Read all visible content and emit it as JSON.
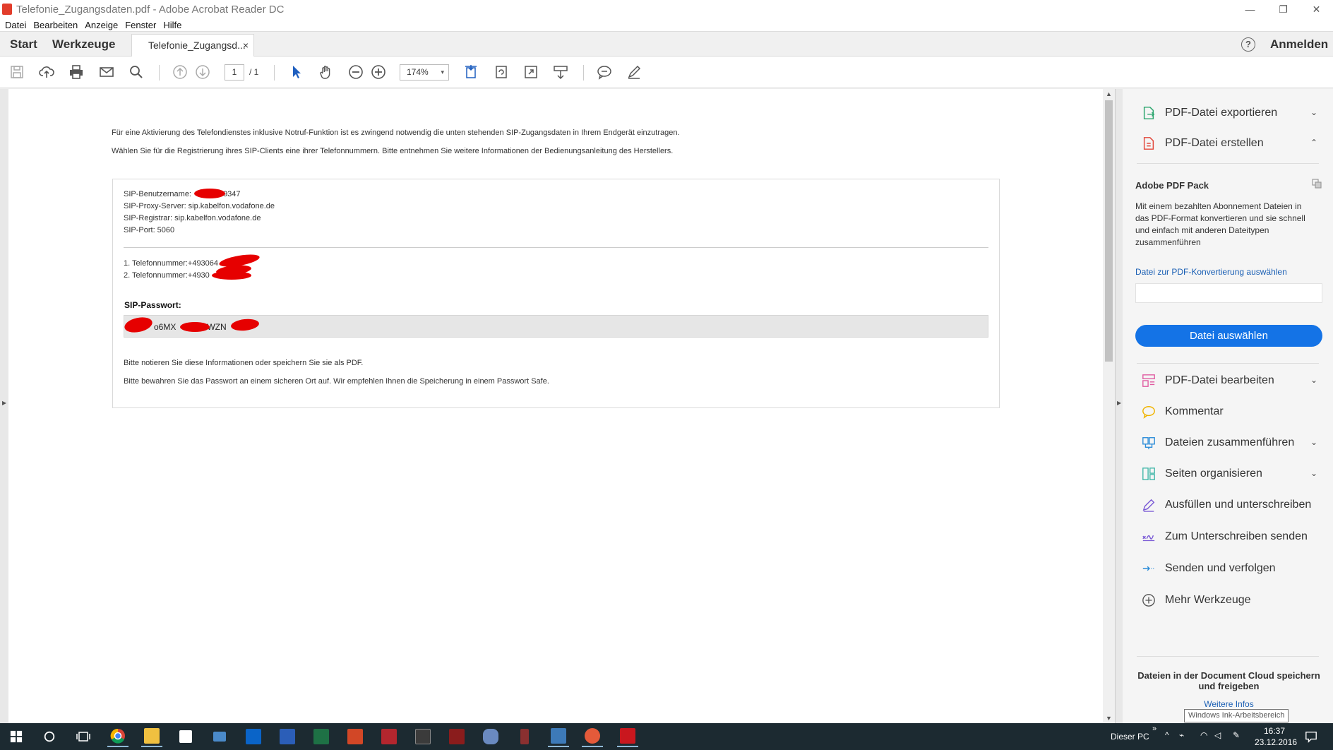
{
  "window": {
    "title": "Telefonie_Zugangsdaten.pdf - Adobe Acrobat Reader DC",
    "minimize_glyph": "—",
    "restore_glyph": "❐",
    "close_glyph": "✕"
  },
  "menu": [
    "Datei",
    "Bearbeiten",
    "Anzeige",
    "Fenster",
    "Hilfe"
  ],
  "tabs": {
    "start": "Start",
    "tools": "Werkzeuge",
    "document": "Telefonie_Zugangsd...",
    "close": "×",
    "help": "?",
    "signin": "Anmelden"
  },
  "toolbar": {
    "page_current": "1",
    "page_total": "/ 1",
    "zoom": "174%",
    "zoom_caret": "▾"
  },
  "document": {
    "intro_line1": "Für eine Aktivierung des Telefondienstes inklusive Notruf-Funktion ist es zwingend notwendig die unten stehenden SIP-Zugangsdaten in Ihrem Endgerät einzutragen.",
    "intro_line2": "Wählen Sie für die Registrierung ihres SIP-Clients eine ihrer Telefonnummern. Bitte entnehmen Sie weitere Informationen der Bedienungsanleitung des Herstellers.",
    "sip_user_label": "SIP-Benutzername:",
    "sip_user_value": "9347",
    "sip_proxy": "SIP-Proxy-Server:  sip.kabelfon.vodafone.de",
    "sip_registrar": "SIP-Registrar:  sip.kabelfon.vodafone.de",
    "sip_port": "SIP-Port:  5060",
    "phone1": "1. Telefonnummer:+493064",
    "phone2": "2. Telefonnummer:+4930",
    "password_label": "SIP-Passwort:",
    "password_part1": "o6MX",
    "password_part2": "kWZN",
    "note1": "Bitte notieren Sie diese Informationen oder speichern Sie sie als PDF.",
    "note2": "Bitte bewahren Sie das Passwort an einem sicheren Ort auf. Wir empfehlen Ihnen die Speicherung in einem Passwort Safe."
  },
  "right_panel": {
    "export": "PDF-Datei exportieren",
    "create": "PDF-Datei erstellen",
    "pack_title": "Adobe PDF Pack",
    "pack_desc": "Mit einem bezahlten Abonnement Dateien in das PDF-Format konvertieren und sie schnell und einfach mit anderen Dateitypen zusammenführen",
    "pack_link": "Datei zur PDF-Konvertierung auswählen",
    "pack_button": "Datei auswählen",
    "edit": "PDF-Datei bearbeiten",
    "comment": "Kommentar",
    "combine": "Dateien zusammenführen",
    "organize": "Seiten organisieren",
    "fill_sign": "Ausfüllen und unterschreiben",
    "send_sign": "Zum Unterschreiben senden",
    "send_track": "Senden und verfolgen",
    "more_tools": "Mehr Werkzeuge",
    "cloud_title": "Dateien in der Document Cloud speichern und freigeben",
    "cloud_link": "Weitere Infos"
  },
  "taskbar": {
    "this_pc": "Dieser PC",
    "tray_chevron": "»",
    "time": "16:37",
    "date": "23.12.2016",
    "tooltip": "Windows Ink-Arbeitsbereich"
  },
  "colors": {
    "accent_blue": "#1473e6",
    "redaction_red": "#e60000",
    "taskbar": "#1c2a31"
  }
}
